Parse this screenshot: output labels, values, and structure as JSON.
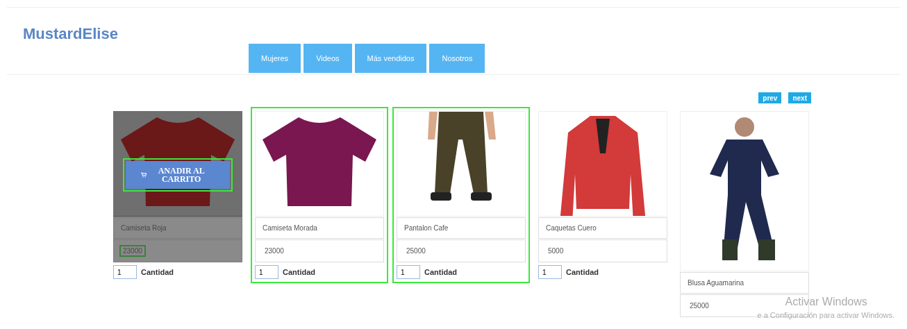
{
  "logo": "MustardElise",
  "nav": [
    {
      "label": "Mujeres"
    },
    {
      "label": "Videos"
    },
    {
      "label": "Más vendidos"
    },
    {
      "label": "Nosotros"
    }
  ],
  "pager": [
    {
      "label": "prev"
    },
    {
      "label": "next"
    }
  ],
  "products": [
    {
      "kind": "tshirt",
      "color": "#6a1818",
      "name": "Camiseta Roja",
      "price": "23000",
      "hovered": true,
      "highlighted": false,
      "price_highlighted": true,
      "add_to_cart": "ANADIR AL CARRITO",
      "quantity": "1",
      "quantity_label": "Cantidad"
    },
    {
      "kind": "tshirt",
      "color": "#7a1650",
      "name": "Camiseta Morada",
      "price": "23000",
      "hovered": false,
      "highlighted": true,
      "price_highlighted": false,
      "quantity": "1",
      "quantity_label": "Cantidad"
    },
    {
      "kind": "pants",
      "color": "#4a4228",
      "name": "Pantalon Cafe",
      "price": "25000",
      "hovered": false,
      "highlighted": true,
      "price_highlighted": false,
      "quantity": "1",
      "quantity_label": "Cantidad"
    },
    {
      "kind": "jacket",
      "color": "#d33a3a",
      "name": "Caquetas Cuero",
      "price": "5000",
      "hovered": false,
      "highlighted": false,
      "price_highlighted": false,
      "quantity": "1",
      "quantity_label": "Cantidad"
    },
    {
      "kind": "coverall",
      "color": "#1f2a4e",
      "name": "Blusa Aguamarina",
      "price": "25000",
      "hovered": false,
      "highlighted": false,
      "price_highlighted": false
    }
  ],
  "os_notice": {
    "title": "Activar Windows",
    "text": "e a Configuración para activar Windows."
  }
}
